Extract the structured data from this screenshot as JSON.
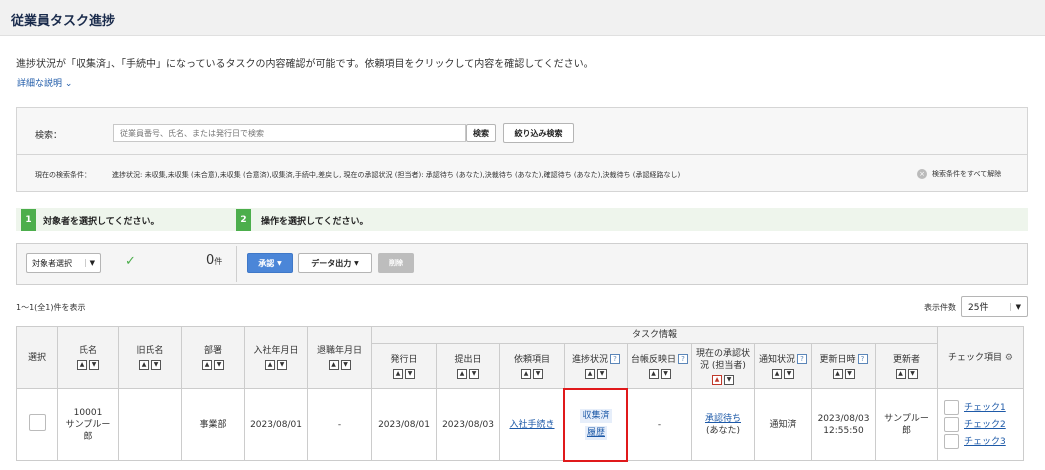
{
  "page": {
    "title": "従業員タスク進捗",
    "description": "進捗状況が「収集済」、「手続中」になっているタスクの内容確認が可能です。依頼項目をクリックして内容を確認してください。",
    "detail_link": "詳細な説明"
  },
  "search": {
    "label": "検索：",
    "placeholder": "従業員番号、氏名、または発行日で検索",
    "search_button": "検索",
    "filter_button": "絞り込み検索",
    "conditions_label": "現在の検索条件：",
    "conditions": "進捗状況: 未収集,未収集 (未合意),未収集 (合意済),収集済,手続中,差戻し, 現在の承認状況 (担当者): 承認待ち (あなた),決裁待ち (あなた),確認待ち (あなた),決裁待ち (承認経路なし)",
    "clear_all": "検索条件をすべて解除"
  },
  "steps": [
    {
      "num": "1",
      "label": "対象者を選択してください。"
    },
    {
      "num": "2",
      "label": "操作を選択してください。"
    }
  ],
  "ops": {
    "select_target": "対象者選択",
    "count": "0",
    "count_unit": "件",
    "approve": "承認",
    "export": "データ出力",
    "delete": "削除"
  },
  "list": {
    "range": "1〜1(全1)件を表示",
    "per_page_label": "表示件数",
    "per_page_value": "25件"
  },
  "table": {
    "headers": {
      "select": "選択",
      "name": "氏名",
      "old_name": "旧氏名",
      "dept": "部署",
      "join_date": "入社年月日",
      "leave_date": "退職年月日",
      "task_info": "タスク情報",
      "issue_date": "発行日",
      "submit_date": "提出日",
      "request_item": "依頼項目",
      "progress": "進捗状況",
      "ledger": "台帳反映日",
      "approval_status": "現在の承認状況 (担当者)",
      "notify_status": "通知状況",
      "updated_at": "更新日時",
      "updater": "更新者",
      "check_items": "チェック項目"
    },
    "row": {
      "employee_no": "10001",
      "name": "サンプルー郎",
      "old_name": "",
      "dept": "事業部",
      "join_date": "2023/08/01",
      "leave_date": "-",
      "issue_date": "2023/08/01",
      "submit_date": "2023/08/03",
      "request_item": "入社手続き",
      "progress": "収集済",
      "history": "履歴",
      "ledger": "-",
      "approval": "承認待ち",
      "approval_sub": "(あなた)",
      "notify": "通知済",
      "updated_date": "2023/08/03",
      "updated_time": "12:55:50",
      "updater": "サンプルー郎",
      "checks": [
        "チェック1",
        "チェック2",
        "チェック3"
      ]
    }
  },
  "colors": {
    "accent": "#4b86d8",
    "step": "#4cae4c",
    "highlight": "#e0191b",
    "link": "#1e5aa8"
  }
}
